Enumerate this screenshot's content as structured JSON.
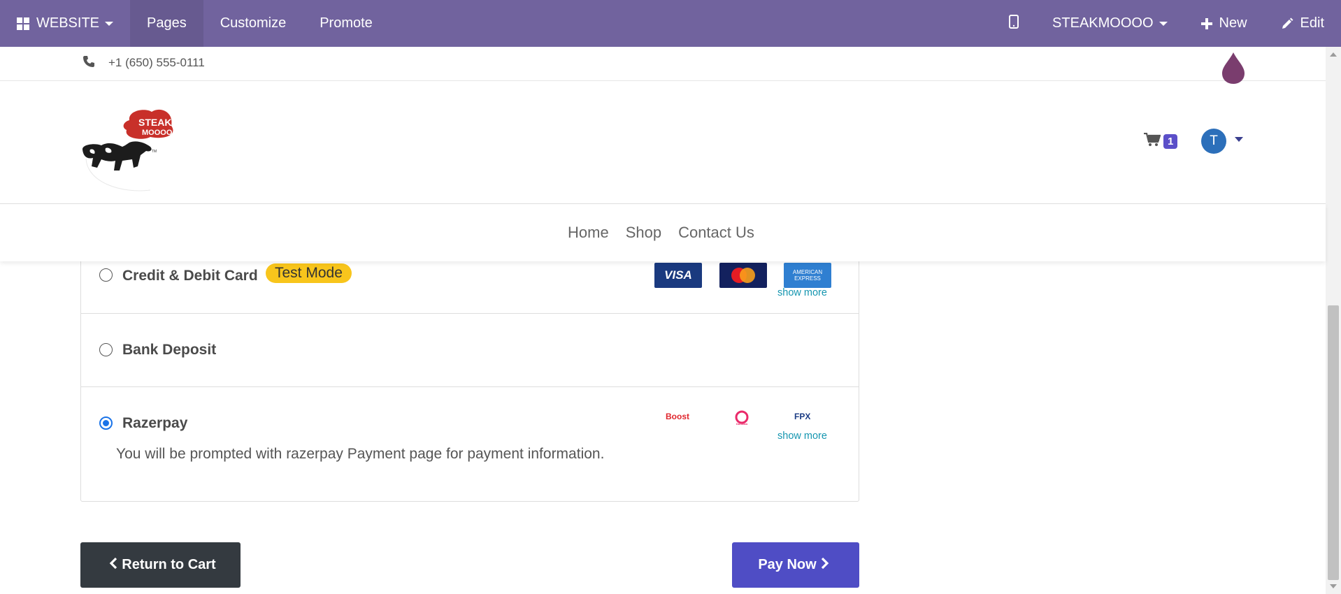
{
  "topbar": {
    "app_menu": "WEBSITE",
    "menu_items": [
      "Pages",
      "Customize",
      "Promote"
    ],
    "website_name": "STEAKMOOOO",
    "new_label": "New",
    "edit_label": "Edit",
    "bg_color": "#71639e"
  },
  "header": {
    "phone": "+1 (650) 555-0111",
    "logo_text_line1": "STEAK",
    "logo_text_line2": "MOOOO",
    "cart_count": "1",
    "avatar_initial": "T",
    "nav": [
      "Home",
      "Shop",
      "Contact Us"
    ]
  },
  "payment": {
    "methods": [
      {
        "label": "Credit & Debit Card",
        "badge": "Test Mode",
        "selected": false,
        "logos": [
          "VISA",
          "MasterCard",
          "AMERICAN EXPRESS"
        ],
        "show_more": "show more"
      },
      {
        "label": "Bank Deposit",
        "selected": false
      },
      {
        "label": "Razerpay",
        "selected": true,
        "description": "You will be prompted with razerpay Payment page for payment information.",
        "logos": [
          "Boost",
          "DuitNow",
          "FPX"
        ],
        "show_more": "show more"
      }
    ]
  },
  "actions": {
    "return_label": "Return to Cart",
    "pay_label": "Pay Now"
  },
  "colors": {
    "accent": "#4f4dc5",
    "badge_yellow": "#f8c51c",
    "link": "#1596b0",
    "dark_button": "#343a40"
  }
}
